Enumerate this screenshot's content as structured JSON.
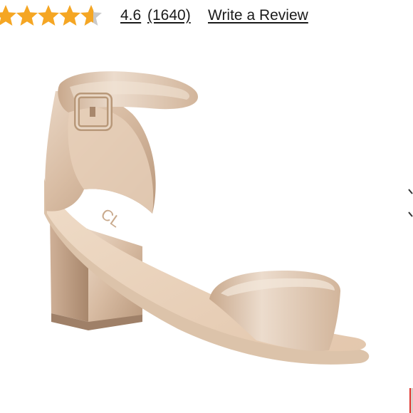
{
  "rating": {
    "score": "4.6",
    "count": "(1640)",
    "write_review_label": "Write a Review",
    "star_value": 4.6,
    "star_max": 5,
    "star_color": "#f5a623",
    "empty_star_color": "#c9c9c9"
  },
  "product": {
    "image_icon": "sandal-image",
    "brand_imprint": "CL"
  },
  "carousel": {
    "next_icon": "chevron-right-icon"
  }
}
